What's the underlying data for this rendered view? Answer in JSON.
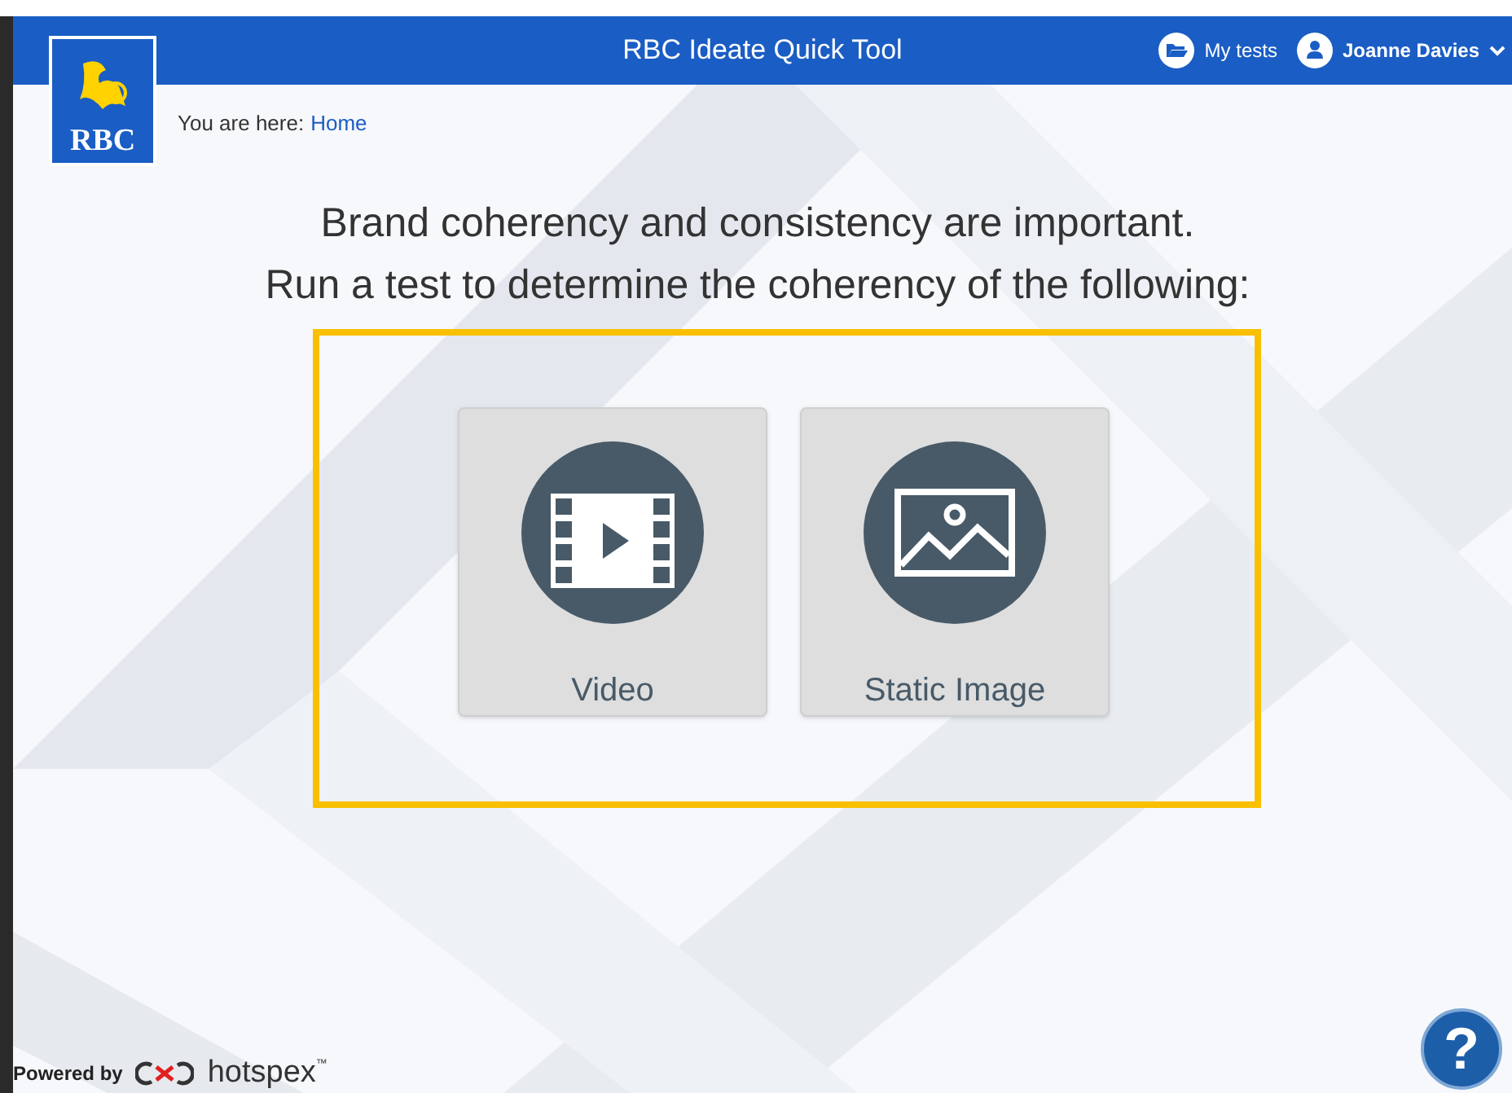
{
  "header": {
    "logo_text": "RBC",
    "title": "RBC Ideate Quick Tool",
    "my_tests": "My tests",
    "user": "Joanne Davies"
  },
  "breadcrumb": {
    "label": "You are here:",
    "link": "Home"
  },
  "headline": [
    "Brand coherency and consistency are important.",
    "Run a test to determine the coherency of the following:"
  ],
  "options": [
    {
      "kind": "video",
      "label": "Video"
    },
    {
      "kind": "image",
      "label": "Static Image"
    }
  ],
  "footer": {
    "powered_by": "Powered by",
    "brand": "hotspex",
    "tm": "™"
  },
  "help": {
    "symbol": "?"
  }
}
